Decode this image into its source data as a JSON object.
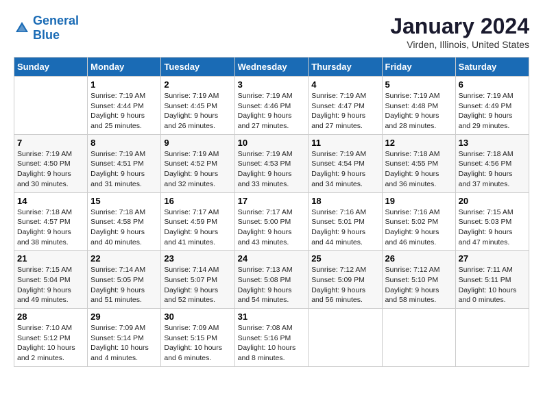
{
  "header": {
    "logo_text_general": "General",
    "logo_text_blue": "Blue",
    "main_title": "January 2024",
    "subtitle": "Virden, Illinois, United States"
  },
  "calendar": {
    "days_of_week": [
      "Sunday",
      "Monday",
      "Tuesday",
      "Wednesday",
      "Thursday",
      "Friday",
      "Saturday"
    ],
    "weeks": [
      [
        {
          "day": "",
          "info": ""
        },
        {
          "day": "1",
          "info": "Sunrise: 7:19 AM\nSunset: 4:44 PM\nDaylight: 9 hours\nand 25 minutes."
        },
        {
          "day": "2",
          "info": "Sunrise: 7:19 AM\nSunset: 4:45 PM\nDaylight: 9 hours\nand 26 minutes."
        },
        {
          "day": "3",
          "info": "Sunrise: 7:19 AM\nSunset: 4:46 PM\nDaylight: 9 hours\nand 27 minutes."
        },
        {
          "day": "4",
          "info": "Sunrise: 7:19 AM\nSunset: 4:47 PM\nDaylight: 9 hours\nand 27 minutes."
        },
        {
          "day": "5",
          "info": "Sunrise: 7:19 AM\nSunset: 4:48 PM\nDaylight: 9 hours\nand 28 minutes."
        },
        {
          "day": "6",
          "info": "Sunrise: 7:19 AM\nSunset: 4:49 PM\nDaylight: 9 hours\nand 29 minutes."
        }
      ],
      [
        {
          "day": "7",
          "info": ""
        },
        {
          "day": "8",
          "info": "Sunrise: 7:19 AM\nSunset: 4:51 PM\nDaylight: 9 hours\nand 31 minutes."
        },
        {
          "day": "9",
          "info": "Sunrise: 7:19 AM\nSunset: 4:52 PM\nDaylight: 9 hours\nand 32 minutes."
        },
        {
          "day": "10",
          "info": "Sunrise: 7:19 AM\nSunset: 4:53 PM\nDaylight: 9 hours\nand 33 minutes."
        },
        {
          "day": "11",
          "info": "Sunrise: 7:19 AM\nSunset: 4:54 PM\nDaylight: 9 hours\nand 34 minutes."
        },
        {
          "day": "12",
          "info": "Sunrise: 7:18 AM\nSunset: 4:55 PM\nDaylight: 9 hours\nand 36 minutes."
        },
        {
          "day": "13",
          "info": "Sunrise: 7:18 AM\nSunset: 4:56 PM\nDaylight: 9 hours\nand 37 minutes."
        }
      ],
      [
        {
          "day": "14",
          "info": ""
        },
        {
          "day": "15",
          "info": "Sunrise: 7:18 AM\nSunset: 4:58 PM\nDaylight: 9 hours\nand 40 minutes."
        },
        {
          "day": "16",
          "info": "Sunrise: 7:17 AM\nSunset: 4:59 PM\nDaylight: 9 hours\nand 41 minutes."
        },
        {
          "day": "17",
          "info": "Sunrise: 7:17 AM\nSunset: 5:00 PM\nDaylight: 9 hours\nand 43 minutes."
        },
        {
          "day": "18",
          "info": "Sunrise: 7:16 AM\nSunset: 5:01 PM\nDaylight: 9 hours\nand 44 minutes."
        },
        {
          "day": "19",
          "info": "Sunrise: 7:16 AM\nSunset: 5:02 PM\nDaylight: 9 hours\nand 46 minutes."
        },
        {
          "day": "20",
          "info": "Sunrise: 7:15 AM\nSunset: 5:03 PM\nDaylight: 9 hours\nand 47 minutes."
        }
      ],
      [
        {
          "day": "21",
          "info": ""
        },
        {
          "day": "22",
          "info": "Sunrise: 7:14 AM\nSunset: 5:05 PM\nDaylight: 9 hours\nand 51 minutes."
        },
        {
          "day": "23",
          "info": "Sunrise: 7:14 AM\nSunset: 5:07 PM\nDaylight: 9 hours\nand 52 minutes."
        },
        {
          "day": "24",
          "info": "Sunrise: 7:13 AM\nSunset: 5:08 PM\nDaylight: 9 hours\nand 54 minutes."
        },
        {
          "day": "25",
          "info": "Sunrise: 7:12 AM\nSunset: 5:09 PM\nDaylight: 9 hours\nand 56 minutes."
        },
        {
          "day": "26",
          "info": "Sunrise: 7:12 AM\nSunset: 5:10 PM\nDaylight: 9 hours\nand 58 minutes."
        },
        {
          "day": "27",
          "info": "Sunrise: 7:11 AM\nSunset: 5:11 PM\nDaylight: 10 hours\nand 0 minutes."
        }
      ],
      [
        {
          "day": "28",
          "info": ""
        },
        {
          "day": "29",
          "info": "Sunrise: 7:09 AM\nSunset: 5:14 PM\nDaylight: 10 hours\nand 4 minutes."
        },
        {
          "day": "30",
          "info": "Sunrise: 7:09 AM\nSunset: 5:15 PM\nDaylight: 10 hours\nand 6 minutes."
        },
        {
          "day": "31",
          "info": "Sunrise: 7:08 AM\nSunset: 5:16 PM\nDaylight: 10 hours\nand 8 minutes."
        },
        {
          "day": "",
          "info": ""
        },
        {
          "day": "",
          "info": ""
        },
        {
          "day": "",
          "info": ""
        }
      ]
    ],
    "week1_sunday": {
      "day": "7",
      "info": "Sunrise: 7:19 AM\nSunset: 4:50 PM\nDaylight: 9 hours\nand 30 minutes."
    },
    "week2_sunday": {
      "day": "14",
      "info": "Sunrise: 7:18 AM\nSunset: 4:57 PM\nDaylight: 9 hours\nand 38 minutes."
    },
    "week3_sunday": {
      "day": "21",
      "info": "Sunrise: 7:15 AM\nSunset: 5:04 PM\nDaylight: 9 hours\nand 49 minutes."
    },
    "week4_sunday": {
      "day": "28",
      "info": "Sunrise: 7:10 AM\nSunset: 5:12 PM\nDaylight: 10 hours\nand 2 minutes."
    }
  }
}
